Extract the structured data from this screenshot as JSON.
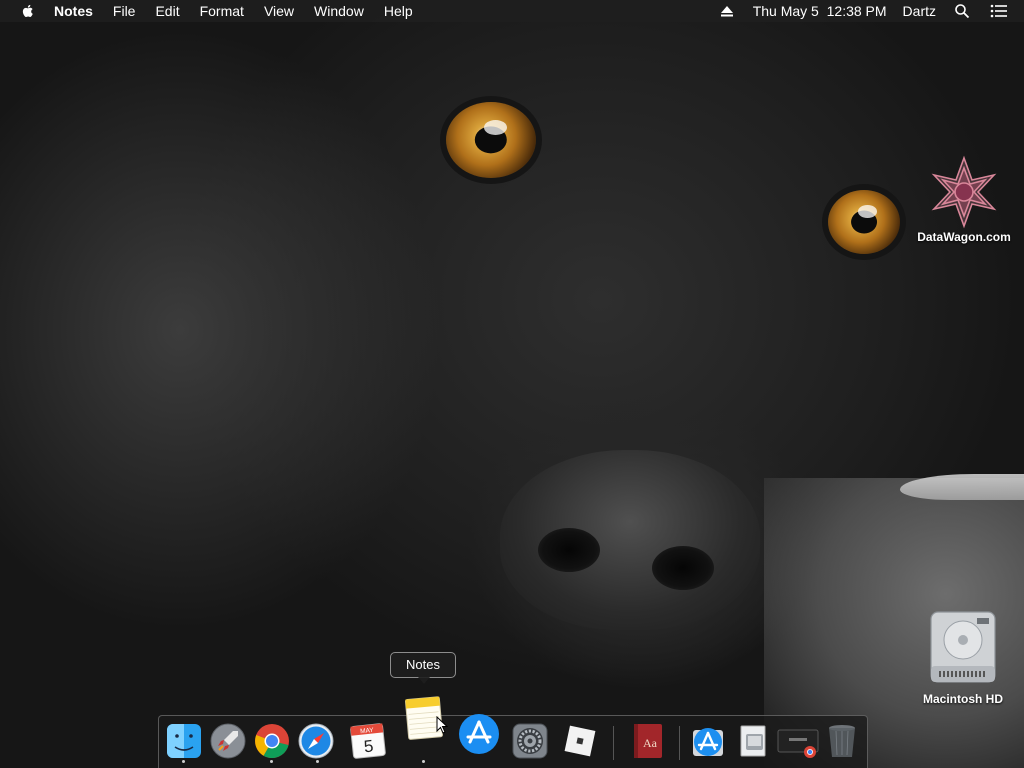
{
  "menubar": {
    "app_name": "Notes",
    "menus": [
      "File",
      "Edit",
      "Format",
      "View",
      "Window",
      "Help"
    ],
    "clock": "Thu May 5  12:38 PM",
    "user": "Dartz",
    "icons": [
      "apple-icon",
      "eject-icon",
      "spotlight-search-icon",
      "notification-center-icon"
    ]
  },
  "desktop": {
    "watermark_label": "DataWagon.com",
    "drive_label": "Macintosh HD"
  },
  "tooltip": {
    "text": "Notes"
  },
  "dock": {
    "items": [
      {
        "name": "Finder",
        "icon": "finder-icon",
        "running": true
      },
      {
        "name": "Launchpad",
        "icon": "launchpad-icon",
        "running": false
      },
      {
        "name": "Google Chrome",
        "icon": "chrome-icon",
        "running": true
      },
      {
        "name": "Safari",
        "icon": "safari-icon",
        "running": true
      },
      {
        "name": "Calendar",
        "icon": "calendar-icon",
        "running": false,
        "month": "MAY",
        "day": "5"
      },
      {
        "name": "Notes",
        "icon": "notes-icon",
        "running": true
      },
      {
        "name": "App Store",
        "icon": "app-store-icon",
        "running": false
      },
      {
        "name": "System Preferences",
        "icon": "system-preferences-icon",
        "running": false
      },
      {
        "name": "Roblox",
        "icon": "roblox-icon",
        "running": false
      },
      {
        "name": "Dictionary",
        "icon": "dictionary-icon",
        "running": false,
        "glyph": "Aa"
      },
      {
        "name": "App Store Download",
        "icon": "app-store-folder-icon",
        "running": false
      },
      {
        "name": "Disk Image",
        "icon": "disk-image-icon",
        "running": false
      },
      {
        "name": "Google Chrome Window",
        "icon": "chrome-window-icon",
        "running": false
      },
      {
        "name": "Trash",
        "icon": "trash-icon",
        "running": false
      }
    ]
  },
  "colors": {
    "menubar_bg": "#1e1e1e",
    "eye_amber": "#b0701a",
    "watermark_pink": "#d9879a"
  }
}
